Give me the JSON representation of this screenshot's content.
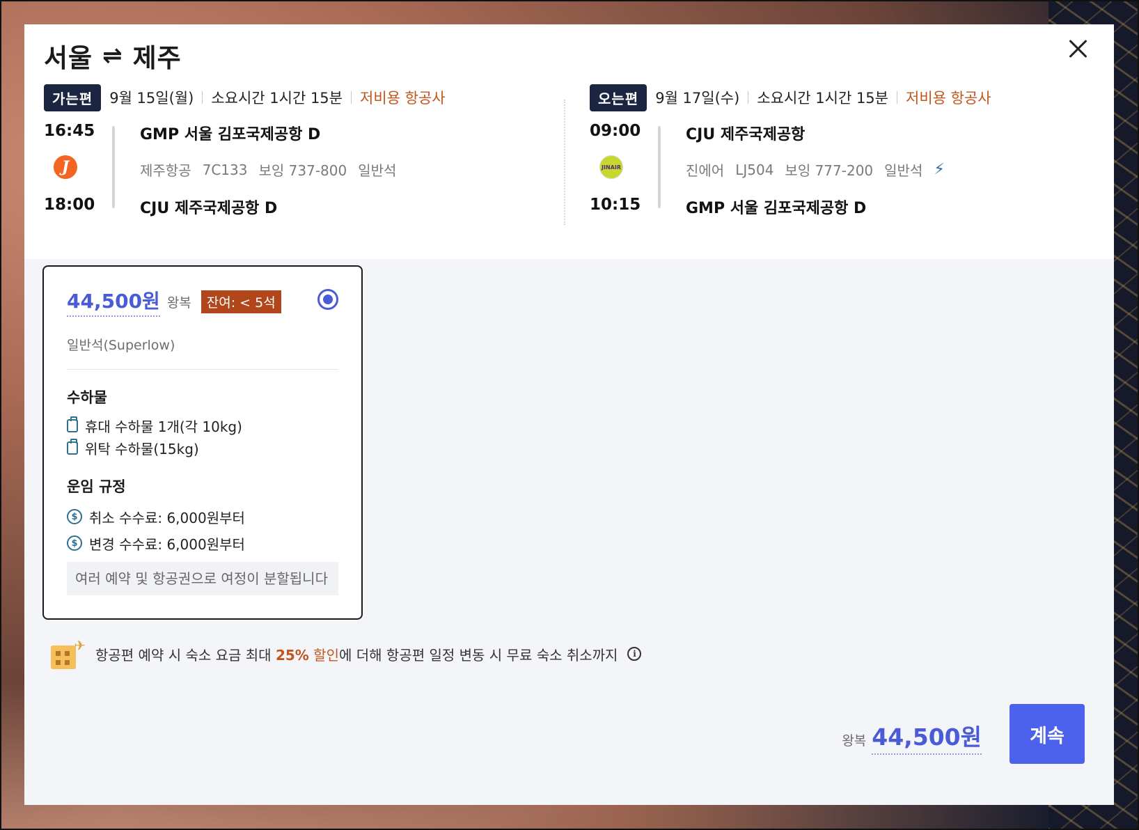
{
  "modal": {
    "title_from": "서울",
    "title_swap": "⇌",
    "title_to": "제주",
    "close_label": "×"
  },
  "outbound": {
    "pill": "가는편",
    "date": "9월 15일(월)",
    "duration": "소요시간 1시간 15분",
    "tag": "저비용 항공사",
    "dep_time": "16:45",
    "arr_time": "18:00",
    "dep_airport": "GMP 서울 김포국제공항 D",
    "arr_airport": "CJU 제주국제공항 D",
    "airline": "제주항공",
    "flight_no": "7C133",
    "aircraft": "보잉 737-800",
    "cabin": "일반석",
    "logo_text": "J"
  },
  "inbound": {
    "pill": "오는편",
    "date": "9월 17일(수)",
    "duration": "소요시간 1시간 15분",
    "tag": "저비용 항공사",
    "dep_time": "09:00",
    "arr_time": "10:15",
    "dep_airport": "CJU 제주국제공항",
    "arr_airport": "GMP 서울 김포국제공항 D",
    "airline": "진에어",
    "flight_no": "LJ504",
    "aircraft": "보잉 777-200",
    "cabin": "일반석",
    "extra_icon": "lightning-icon",
    "logo_text": "JINAIR"
  },
  "fare": {
    "price": "44,500원",
    "price_type": "왕복",
    "seats_left": "잔여: < 5석",
    "fare_class": "일반석(Superlow)",
    "baggage_title": "수하물",
    "carry_on": "휴대 수하물 1개(각 10kg)",
    "checked": "위탁 수하물(15kg)",
    "rules_title": "운임 규정",
    "cancel_fee": "취소 수수료: 6,000원부터",
    "change_fee": "변경 수수료: 6,000원부터",
    "notice": "여러 예약 및 항공권으로 여정이 분할됩니다",
    "selected": true
  },
  "promo": {
    "text_before": "항공편 예약 시 숙소 요금 최대 ",
    "highlight_pct": "25%",
    "highlight_word": " 할인",
    "text_after": "에 더해 항공편 일정 변동 시 무료 숙소 취소까지",
    "info_glyph": "i"
  },
  "footer": {
    "total_label": "왕복",
    "total_amount": "44,500원",
    "continue_label": "계속"
  },
  "colors": {
    "accent": "#4a5bd6",
    "button": "#4c62ec",
    "lowcost": "#c2551c",
    "badge": "#b1461b",
    "pill": "#1b2440"
  }
}
